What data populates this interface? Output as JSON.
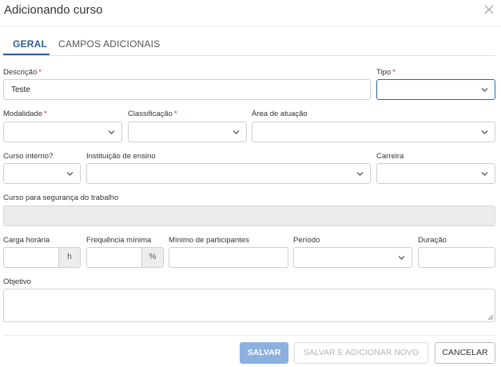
{
  "dialog": {
    "title": "Adicionando curso"
  },
  "tabs": [
    {
      "label": "GERAL",
      "active": true
    },
    {
      "label": "CAMPOS ADICIONAIS",
      "active": false
    }
  ],
  "form": {
    "descricao": {
      "label": "Descrição",
      "required": "*",
      "value": "Teste"
    },
    "tipo": {
      "label": "Tipo",
      "required": "*",
      "value": ""
    },
    "modalidade": {
      "label": "Modalidade",
      "required": "*",
      "value": ""
    },
    "classificacao": {
      "label": "Classificação",
      "required": "*",
      "value": ""
    },
    "area_atuacao": {
      "label": "Área de atuação",
      "value": ""
    },
    "curso_interno": {
      "label": "Curso interno?",
      "value": ""
    },
    "instituicao": {
      "label": "Instituição de ensino",
      "value": ""
    },
    "carreira": {
      "label": "Carreira",
      "value": ""
    },
    "seguranca": {
      "label": "Curso para segurança do trabalho",
      "value": ""
    },
    "carga_horaria": {
      "label": "Carga horária",
      "unit": "h",
      "value": ""
    },
    "frequencia": {
      "label": "Frequência mínima",
      "unit": "%",
      "value": ""
    },
    "minimo_participantes": {
      "label": "Mínimo de participantes",
      "value": ""
    },
    "periodo": {
      "label": "Período",
      "value": ""
    },
    "duracao": {
      "label": "Duração",
      "value": ""
    },
    "objetivo": {
      "label": "Objetivo",
      "value": ""
    }
  },
  "footer": {
    "save_label": "SALVAR",
    "save_add_label": "SALVAR E ADICIONAR NOVO",
    "cancel_label": "CANCELAR"
  },
  "colors": {
    "accent": "#2e5f95",
    "required": "#dd2233",
    "save_button": "#8cb0e0"
  },
  "icons": {
    "close": "close-icon",
    "dropdown": "chevron-down-icon",
    "resize": "resize-grip-icon"
  }
}
